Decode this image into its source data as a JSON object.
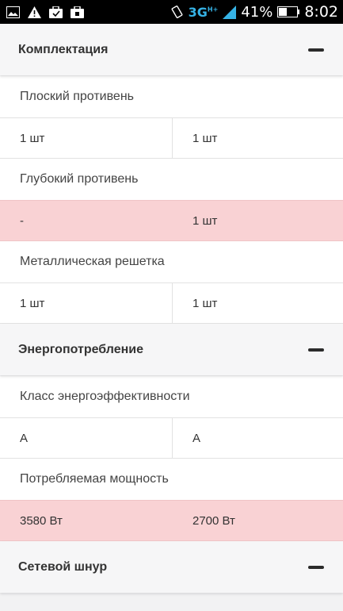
{
  "status_bar": {
    "network": "3G",
    "network_sup": "H+",
    "battery": "41%",
    "time": "8:02",
    "icons": [
      "image-icon",
      "warning-icon",
      "briefcase-icon",
      "briefcase-icon",
      "vibrate-icon",
      "signal-icon",
      "battery-icon"
    ]
  },
  "sections": {
    "s1": {
      "title": "Комплектация"
    },
    "s2": {
      "title": "Энергопотребление"
    },
    "s3": {
      "title": "Сетевой шнур"
    }
  },
  "params": {
    "p1": {
      "label": "Плоский противень",
      "left": "1 шт",
      "right": "1 шт",
      "differs": false
    },
    "p2": {
      "label": "Глубокий противень",
      "left": "-",
      "right": "1 шт",
      "differs": true
    },
    "p3": {
      "label": "Металлическая решетка",
      "left": "1 шт",
      "right": "1 шт",
      "differs": false
    },
    "p4": {
      "label": "Класс энергоэффективности",
      "left": "A",
      "right": "A",
      "differs": false
    },
    "p5": {
      "label": "Потребляемая мощность",
      "left": "3580 Вт",
      "right": "2700 Вт",
      "differs": true
    }
  },
  "colors": {
    "diff_row": "#f9d2d4",
    "header_bg": "#f6f6f7",
    "network": "#36b3e6"
  }
}
